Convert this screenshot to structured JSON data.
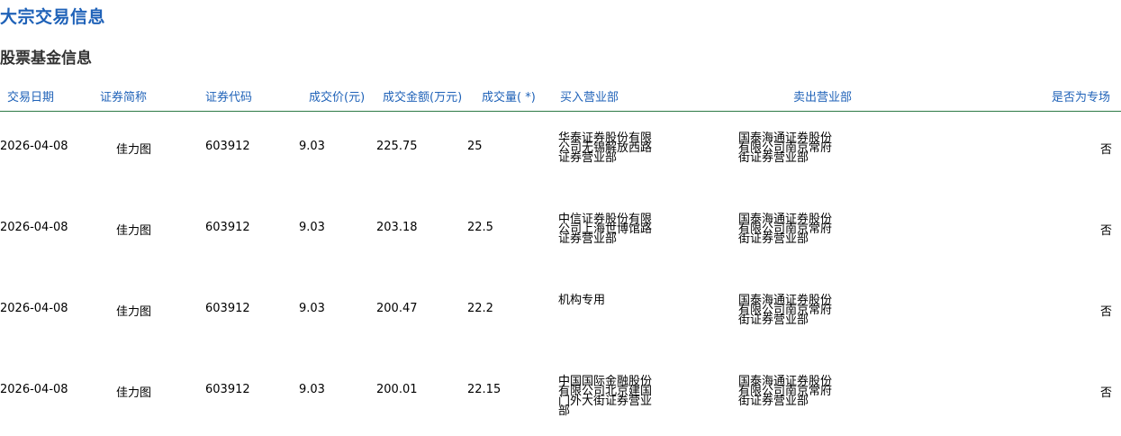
{
  "page_title": "大宗交易信息",
  "section_title": "股票基金信息",
  "columns": {
    "date": "交易日期",
    "name": "证券简称",
    "code": "证券代码",
    "price": "成交价(元)",
    "amount": "成交金额(万元)",
    "volume": "成交量( *)",
    "buyer": "买入营业部",
    "seller": "卖出营业部",
    "special": "是否为专场"
  },
  "rows": [
    {
      "date": "2026-04-08",
      "name": "佳力图",
      "code": "603912",
      "price": "9.03",
      "amount": "225.75",
      "volume": "25",
      "buyer": "华泰证券股份有限公司无锡解放西路证券营业部",
      "seller": "国泰海通证券股份有限公司南京常府街证券营业部",
      "special": "否"
    },
    {
      "date": "2026-04-08",
      "name": "佳力图",
      "code": "603912",
      "price": "9.03",
      "amount": "203.18",
      "volume": "22.5",
      "buyer": "中信证券股份有限公司上海世博馆路证券营业部",
      "seller": "国泰海通证券股份有限公司南京常府街证券营业部",
      "special": "否"
    },
    {
      "date": "2026-04-08",
      "name": "佳力图",
      "code": "603912",
      "price": "9.03",
      "amount": "200.47",
      "volume": "22.2",
      "buyer": "机构专用",
      "seller": "国泰海通证券股份有限公司南京常府街证券营业部",
      "special": "否"
    },
    {
      "date": "2026-04-08",
      "name": "佳力图",
      "code": "603912",
      "price": "9.03",
      "amount": "200.01",
      "volume": "22.15",
      "buyer": "中国国际金融股份有限公司北京建国门外大街证券营业部",
      "seller": "国泰海通证券股份有限公司南京常府街证券营业部",
      "special": "否"
    }
  ]
}
